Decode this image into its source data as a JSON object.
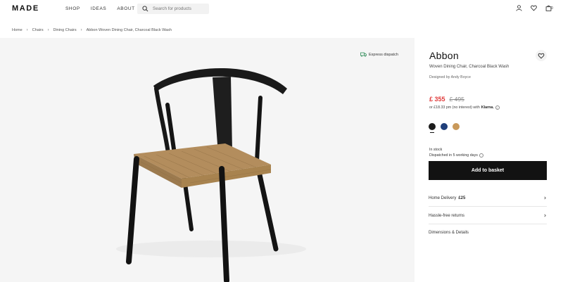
{
  "header": {
    "logo": "MADE",
    "nav": [
      "SHOP",
      "IDEAS",
      "ABOUT"
    ],
    "search_placeholder": "Search for products",
    "bag_count": "0",
    "icons": [
      "user-icon",
      "heart-icon",
      "bag-icon"
    ]
  },
  "breadcrumb": [
    "Home",
    "Chairs",
    "Dining Chairs",
    "Abbon Woven Dining Chair, Charcoal Black Wash"
  ],
  "image": {
    "badge": "Express dispatch"
  },
  "product": {
    "title": "Abbon",
    "subtitle": "Woven Dining Chair, Charcoal Black Wash",
    "designer": "Designed by Andy Boyce",
    "price_now": "£ 355",
    "price_was": "£ 495",
    "finance_text": "or £18.33 pm (no interest) with",
    "finance_brand": "Klarna.",
    "finance_info": "i",
    "swatches": [
      {
        "name": "charcoal-black",
        "color": "#1c1c1c",
        "selected": true
      },
      {
        "name": "blue",
        "color": "#1f3f7a",
        "selected": false
      },
      {
        "name": "natural",
        "color": "#c9995a",
        "selected": false
      }
    ],
    "stock_status": "In stock",
    "dispatch_info": "Dispatched in 5 working days",
    "add_to_basket": "Add to basket",
    "accordions": [
      {
        "label": "Home Delivery",
        "value": "£25"
      },
      {
        "label": "Hassle-free returns",
        "value": ""
      },
      {
        "label": "Dimensions & Details",
        "value": ""
      }
    ]
  },
  "colors": {
    "sale": "#e03a3a",
    "button": "#121212",
    "image_bg": "#f5f5f5"
  }
}
